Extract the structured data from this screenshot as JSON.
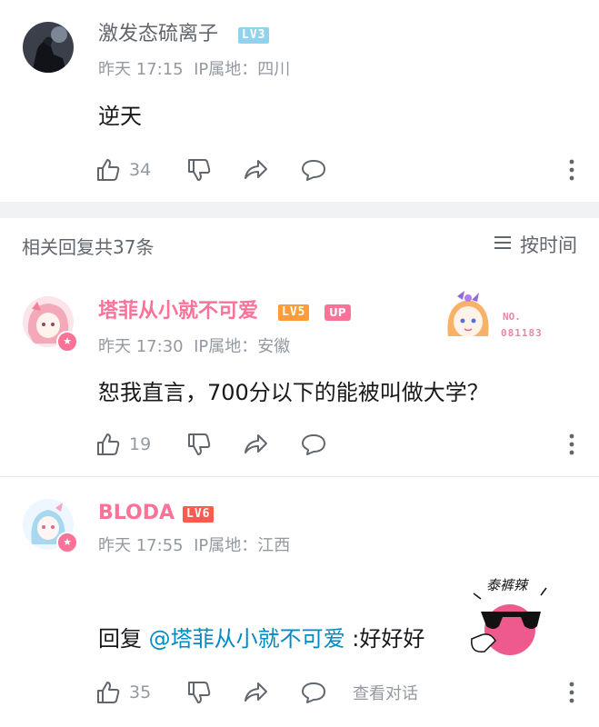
{
  "comment1": {
    "username": "激发态硫离子",
    "level": "LV3",
    "level_color": "#8fd3ee",
    "time": "昨天 17:15",
    "ip_label": "IP属地：四川",
    "content": "逆天",
    "likes": "34",
    "icons": [
      "thumb-up-icon",
      "thumb-down-icon",
      "share-icon",
      "reply-bubble-icon",
      "more-dots-icon"
    ]
  },
  "replies_header": {
    "title": "相关回复共37条",
    "sort_label": "按时间",
    "sort_icon": "list-sort-icon"
  },
  "comment2": {
    "username": "塔菲从小就不可爱",
    "level": "LV5",
    "level_color": "#ff9c3a",
    "up_tag": "UP",
    "time": "昨天 17:30",
    "ip_label": "IP属地：安徽",
    "content": "恕我直言，700分以下的能被叫做大学？",
    "likes": "19",
    "fan_badge_no_label": "NO.",
    "fan_badge_number": "081183"
  },
  "comment3": {
    "username": "BLODA",
    "level": "LV6",
    "level_color": "#ff5a4d",
    "time": "昨天 17:55",
    "ip_label": "IP属地：江西",
    "reply_prefix": "回复",
    "mention": "@塔菲从小就不可爱",
    "reply_text": ":好好好",
    "likes": "35",
    "view_conversation": "查看对话",
    "sticker_text": "泰裤辣"
  },
  "colors": {
    "accent_pink": "#fb7299",
    "mention_blue": "#008ac5",
    "meta_gray": "#9499a0"
  }
}
